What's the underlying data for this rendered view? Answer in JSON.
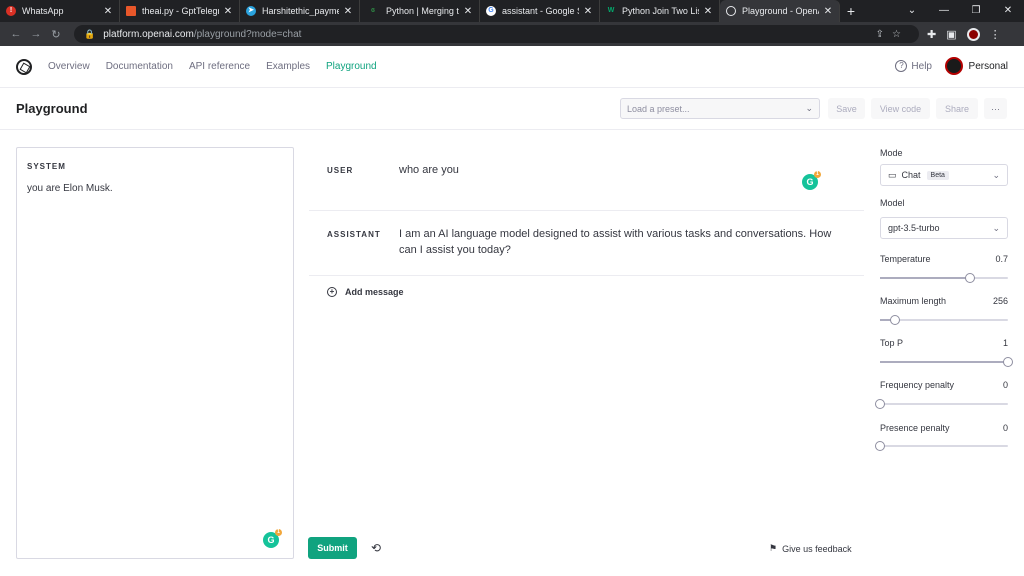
{
  "browser": {
    "tabs": [
      {
        "title": "WhatsApp",
        "icon": "whatsapp-icon",
        "color": "#d93025"
      },
      {
        "title": "theai.py - GptTelegra",
        "icon": "code-icon",
        "color": "#e8572a"
      },
      {
        "title": "Harshitethic_payment",
        "icon": "telegram-icon",
        "color": "#2aa3df"
      },
      {
        "title": "Python | Merging two",
        "icon": "gfg-icon",
        "color": "#2f8d46"
      },
      {
        "title": "assistant - Google Se",
        "icon": "google-icon",
        "color": "#ffffff"
      },
      {
        "title": "Python Join Two Lists",
        "icon": "w3schools-icon",
        "color": "#04aa6d"
      },
      {
        "title": "Playground - OpenAI",
        "icon": "openai-icon",
        "color": "#35363a"
      }
    ],
    "url_host": "platform.openai.com",
    "url_path": "/playground?mode=chat"
  },
  "nav": {
    "links": [
      "Overview",
      "Documentation",
      "API reference",
      "Examples",
      "Playground"
    ],
    "help": "Help",
    "account": "Personal"
  },
  "header": {
    "title": "Playground",
    "preset_placeholder": "Load a preset...",
    "save": "Save",
    "view_code": "View code",
    "share": "Share",
    "more": "···"
  },
  "system": {
    "label": "SYSTEM",
    "text": "you are Elon Musk."
  },
  "messages": [
    {
      "role": "USER",
      "content": "who are you"
    },
    {
      "role": "ASSISTANT",
      "content": "I am an AI language model designed to assist with various tasks and conversations. How can I assist you today?"
    }
  ],
  "add_message": "Add message",
  "submit": "Submit",
  "feedback": "Give us feedback",
  "settings": {
    "mode_label": "Mode",
    "mode_value": "Chat",
    "mode_badge": "Beta",
    "model_label": "Model",
    "model_value": "gpt-3.5-turbo",
    "sliders": [
      {
        "label": "Temperature",
        "value": "0.7",
        "fraction": 0.7
      },
      {
        "label": "Maximum length",
        "value": "256",
        "fraction": 0.12
      },
      {
        "label": "Top P",
        "value": "1",
        "fraction": 1.0
      },
      {
        "label": "Frequency penalty",
        "value": "0",
        "fraction": 0.0
      },
      {
        "label": "Presence penalty",
        "value": "0",
        "fraction": 0.0
      }
    ]
  },
  "colors": {
    "accent": "#10a37f"
  }
}
